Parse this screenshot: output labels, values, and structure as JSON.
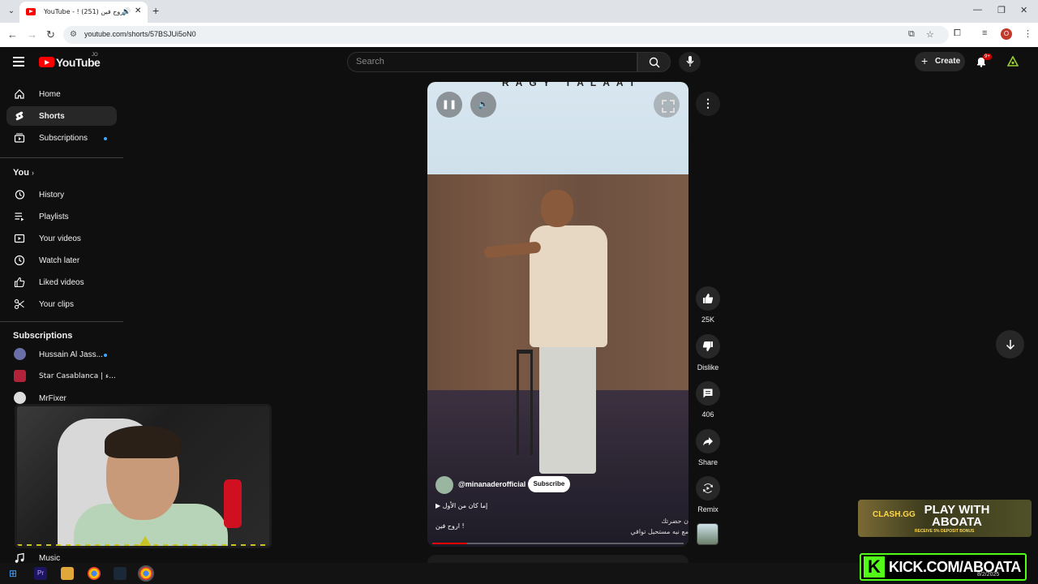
{
  "browser": {
    "tab_title": "YouTube - ! اروح فين (251)",
    "url": "youtube.com/shorts/57BSJUi5oN0",
    "profile_initial": "O"
  },
  "header": {
    "logo_text": "YouTube",
    "country_code": "JO",
    "search_placeholder": "Search",
    "create_label": "Create",
    "notification_count": "9+"
  },
  "sidebar": {
    "main": [
      {
        "label": "Home",
        "icon": "home-icon"
      },
      {
        "label": "Shorts",
        "icon": "shorts-icon",
        "active": true
      },
      {
        "label": "Subscriptions",
        "icon": "subscriptions-icon",
        "dot": true
      }
    ],
    "you_heading": "You",
    "you_items": [
      {
        "label": "History",
        "icon": "history-icon"
      },
      {
        "label": "Playlists",
        "icon": "playlists-icon"
      },
      {
        "label": "Your videos",
        "icon": "your-videos-icon"
      },
      {
        "label": "Watch later",
        "icon": "watch-later-icon"
      },
      {
        "label": "Liked videos",
        "icon": "liked-videos-icon"
      },
      {
        "label": "Your clips",
        "icon": "clips-icon"
      }
    ],
    "subscriptions_heading": "Subscriptions",
    "subscriptions": [
      {
        "label": "Hussain Al Jass...",
        "dot": true
      },
      {
        "label": "Star Casablanca | ء..."
      },
      {
        "label": "MrFixer"
      }
    ],
    "music_label": "Music"
  },
  "short": {
    "banner_text": "RAGY TALAAT",
    "channel": "@minanaderofficial",
    "subscribe_label": "Subscribe",
    "audio_title": "إما كان من الأول",
    "caption": "اروح فين !",
    "overlay_line1": "ن حضرتك",
    "overlay_line2": "مع نيه مستحيل توافي",
    "progress": 0.14
  },
  "actions": {
    "likes": "25K",
    "dislike_label": "Dislike",
    "comments": "406",
    "share_label": "Share",
    "remix_label": "Remix"
  },
  "ads": {
    "clash_brand": "CLASH.GG",
    "clash_headline": "PLAY WITH ABOATA",
    "clash_bonus": "RECEIVE 5% DEPOSIT BONUS",
    "kick_text": "KICK.COM/ABOATA"
  },
  "taskbar": {
    "clock": "8/2/2025"
  },
  "colors": {
    "youtube_red": "#ff0000",
    "background": "#0f0f0f",
    "kick_green": "#53fc18"
  }
}
